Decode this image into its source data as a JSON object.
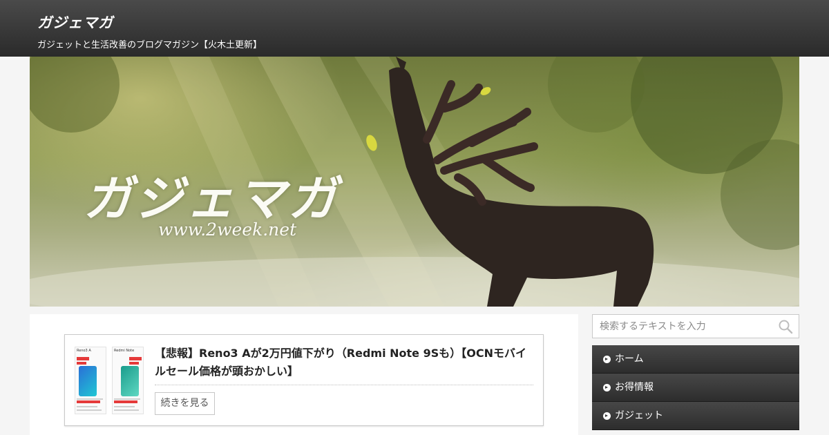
{
  "header": {
    "site_title": "ガジェマガ",
    "site_description": "ガジェットと生活改善のブログマガジン【火木土更新】"
  },
  "hero": {
    "logo_text": "ガジェマガ",
    "url_text": "www.2week.net"
  },
  "post": {
    "title": "【悲報】Reno3 Aが2万円値下がり（Redmi Note 9Sも）【OCNモバイルセール価格が頭おかしい】",
    "read_more_label": "続きを見る",
    "thumbnail": {
      "left_label": "Reno3 A",
      "right_label": "Redmi Note"
    }
  },
  "sidebar": {
    "search_placeholder": "検索するテキストを入力",
    "search_icon": "search-icon",
    "nav_items": [
      {
        "label": "ホーム",
        "icon": "circle-arrow-icon"
      },
      {
        "label": "お得情報",
        "icon": "circle-arrow-icon"
      },
      {
        "label": "ガジェット",
        "icon": "circle-arrow-icon"
      }
    ]
  },
  "colors": {
    "header_bg": "#333333",
    "nav_bg": "#3a3a3a",
    "accent_red": "#e53a3a"
  }
}
